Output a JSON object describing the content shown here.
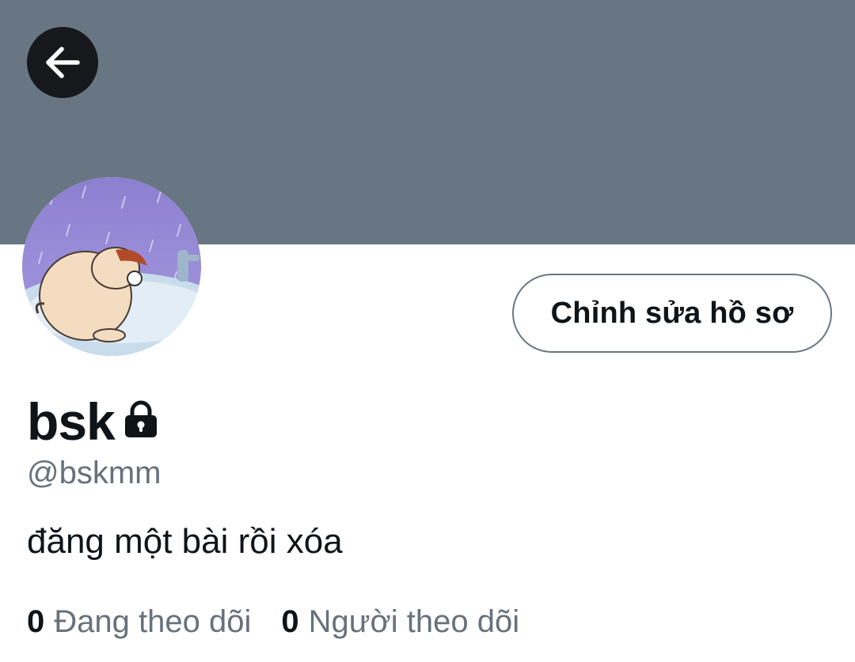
{
  "header": {
    "banner_color": "#687684",
    "back_icon": "arrow-left-icon"
  },
  "profile": {
    "avatar_alt": "cartoon character standing in the rain",
    "edit_button_label": "Chỉnh sửa hồ sơ",
    "display_name": "bsk",
    "protected_icon": "lock-icon",
    "handle": "@bskmm",
    "bio": "đăng một bài rồi xóa"
  },
  "stats": {
    "following": {
      "count": "0",
      "label": "Đang theo dõi"
    },
    "followers": {
      "count": "0",
      "label": "Người theo dõi"
    }
  },
  "colors": {
    "text_primary": "#0f1419",
    "text_secondary": "#67717b",
    "button_border": "#6b7680",
    "back_button_bg": "#16181c"
  }
}
